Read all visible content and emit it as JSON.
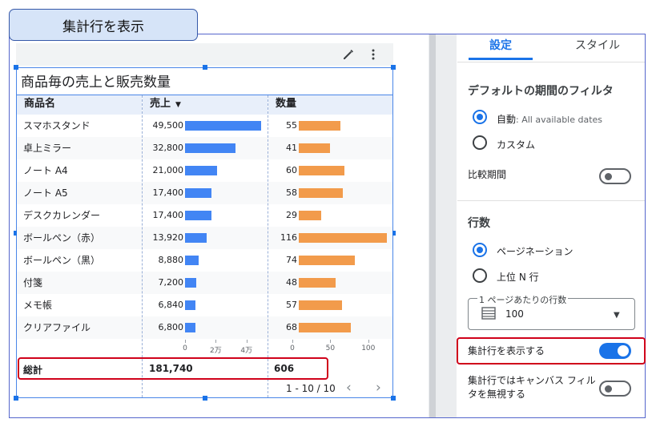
{
  "annotation": {
    "title": "集計行を表示"
  },
  "chart": {
    "title": "商品毎の売上と販売数量",
    "columns": {
      "name": "商品名",
      "sales": "売上",
      "qty": "数量"
    },
    "rows": [
      {
        "name": "スマホスタンド",
        "sales": "49,500",
        "qty": "55"
      },
      {
        "name": "卓上ミラー",
        "sales": "32,800",
        "qty": "41"
      },
      {
        "name": "ノート A4",
        "sales": "21,000",
        "qty": "60"
      },
      {
        "name": "ノート A5",
        "sales": "17,400",
        "qty": "58"
      },
      {
        "name": "デスクカレンダー",
        "sales": "17,400",
        "qty": "29"
      },
      {
        "name": "ボールペン（赤）",
        "sales": "13,920",
        "qty": "116"
      },
      {
        "name": "ボールペン（黒）",
        "sales": "8,880",
        "qty": "74"
      },
      {
        "name": "付箋",
        "sales": "7,200",
        "qty": "48"
      },
      {
        "name": "メモ帳",
        "sales": "6,840",
        "qty": "57"
      },
      {
        "name": "クリアファイル",
        "sales": "6,800",
        "qty": "68"
      }
    ],
    "sales_axis_ticks": [
      "0",
      "2万",
      "4万"
    ],
    "qty_axis_ticks": [
      "0",
      "50",
      "100"
    ],
    "total": {
      "label": "総計",
      "sales": "181,740",
      "qty": "606"
    },
    "pagination": "1 - 10 / 10",
    "colors": {
      "sales_bar": "#4285f4",
      "qty_bar": "#f29b4b",
      "highlight": "#d0021b"
    }
  },
  "chart_data": {
    "type": "table",
    "categories": [
      "スマホスタンド",
      "卓上ミラー",
      "ノート A4",
      "ノート A5",
      "デスクカレンダー",
      "ボールペン（赤）",
      "ボールペン（黒）",
      "付箋",
      "メモ帳",
      "クリアファイル"
    ],
    "series": [
      {
        "name": "売上",
        "values": [
          49500,
          32800,
          21000,
          17400,
          17400,
          13920,
          8880,
          7200,
          6840,
          6800
        ]
      },
      {
        "name": "数量",
        "values": [
          55,
          41,
          60,
          58,
          29,
          116,
          74,
          48,
          57,
          68
        ]
      }
    ],
    "sales_axis_range": [
      0,
      50000
    ],
    "qty_axis_range": [
      0,
      116
    ]
  },
  "panel": {
    "tabs": [
      "設定",
      "スタイル"
    ],
    "date_filter": {
      "title": "デフォルトの期間のフィルタ",
      "auto_label": "自動",
      "auto_hint": ": All available dates",
      "custom_label": "カスタム"
    },
    "compare_label": "比較期間",
    "rows": {
      "title": "行数",
      "pagination_label": "ページネーション",
      "topn_label": "上位 N 行",
      "per_page_legend": "1 ページあたりの行数",
      "per_page_value": "100"
    },
    "show_summary_label": "集計行を表示する",
    "ignore_filter_label": [
      "集計行ではキャンバス フィル",
      "タを無視する"
    ]
  }
}
